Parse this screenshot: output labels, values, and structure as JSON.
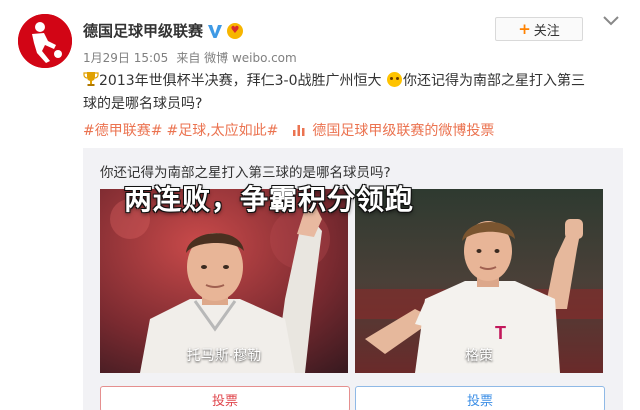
{
  "account": {
    "name": "德国足球甲级联赛",
    "avatar_icon": "bundesliga-logo-icon",
    "brand_color": "#d20515"
  },
  "meta": {
    "date": "1月29日 15:05",
    "source_prefix": "来自",
    "source": "微博 weibo.com"
  },
  "follow": {
    "label": "关注"
  },
  "post": {
    "line1_a": "2013年世俱杯半决赛，拜仁3-0战胜广州恒大",
    "line1_b": "你还记得为南部之星打入第三",
    "line2": "球的是哪名球员吗?",
    "tags": [
      "#德甲联赛#",
      "#足球,太应如此#"
    ],
    "vote_link": "德国足球甲级联赛的微博投票",
    "accent_color": "#eb7350"
  },
  "poll": {
    "question": "你还记得为南部之星打入第三球的是哪名球员吗?",
    "options": [
      {
        "name": "托马斯·穆勒",
        "vote": "投票"
      },
      {
        "name": "格策",
        "vote": "投票"
      }
    ]
  },
  "overlay": {
    "headline": "两连败，争霸积分领跑"
  }
}
